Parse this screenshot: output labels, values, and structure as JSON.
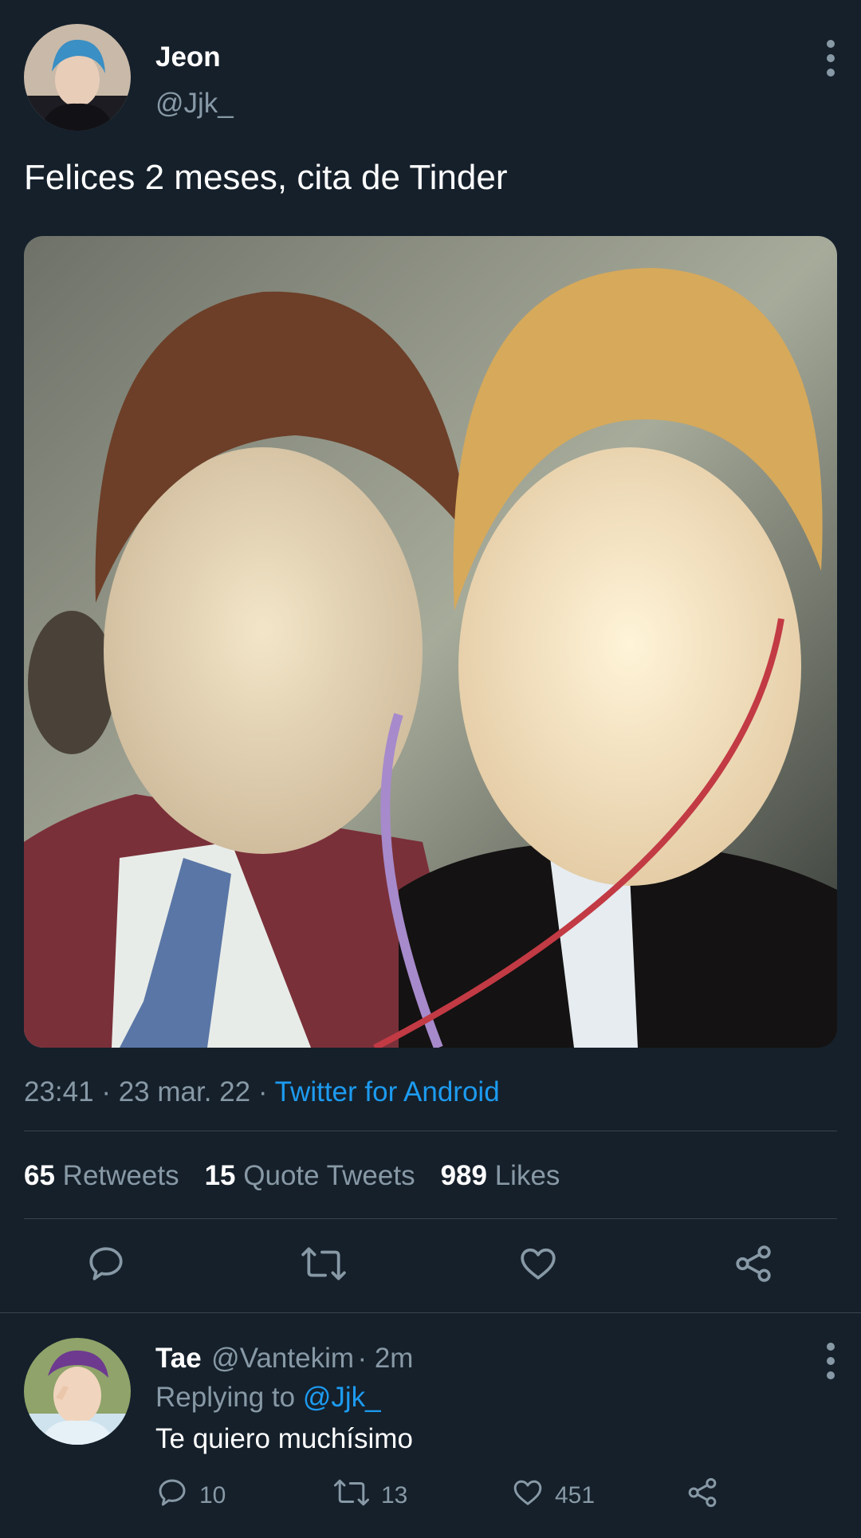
{
  "tweet": {
    "author": {
      "name": "Jeon",
      "handle": "@Jjk_",
      "avatar_icon": "profile-photo"
    },
    "text": "Felices 2 meses, cita de Tinder",
    "media_icon": "photo-two-people-selfie",
    "time": "23:41",
    "date": "23 mar. 22",
    "separator": "·",
    "source": "Twitter for Android",
    "stats": {
      "retweets_count": "65",
      "retweets_label": "Retweets",
      "quotes_count": "15",
      "quotes_label": "Quote Tweets",
      "likes_count": "989",
      "likes_label": "Likes"
    },
    "actions": [
      "reply-icon",
      "retweet-icon",
      "like-icon",
      "share-icon"
    ]
  },
  "reply": {
    "author": {
      "name": "Tae",
      "handle": "@Vantekim",
      "time": "· 2m",
      "avatar_icon": "profile-photo"
    },
    "replying_label": "Replying to",
    "replying_to": "@Jjk_",
    "text": "Te quiero muchísimo",
    "counts": {
      "replies": "10",
      "retweets": "13",
      "likes": "451"
    }
  },
  "colors": {
    "background": "#15202b",
    "text_primary": "#ffffff",
    "text_secondary": "#8899a6",
    "accent": "#1d9bf0",
    "divider": "#38444d"
  }
}
